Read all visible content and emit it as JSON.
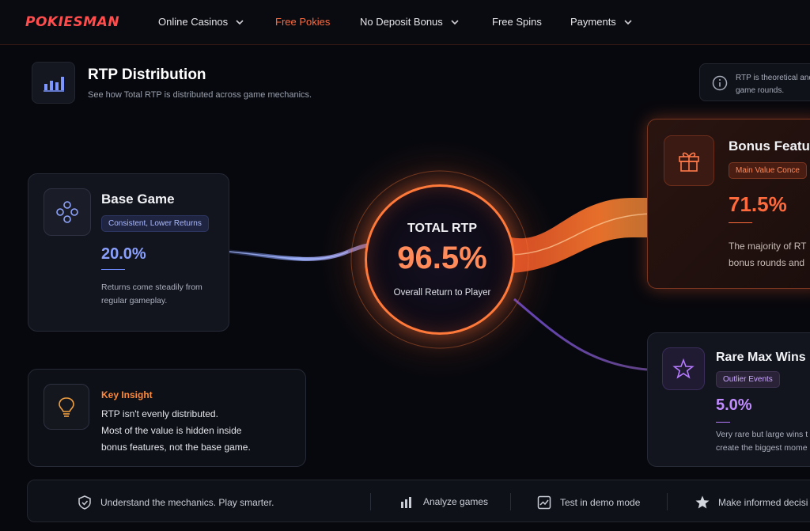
{
  "brand": {
    "logo": "POKIESMAN"
  },
  "nav": {
    "items": [
      {
        "label": "Online Casinos",
        "dropdown": true
      },
      {
        "label": "Free Pokies",
        "active": true
      },
      {
        "label": "No Deposit Bonus",
        "dropdown": true
      },
      {
        "label": "Free Spins"
      },
      {
        "label": "Payments",
        "dropdown": true
      }
    ]
  },
  "header": {
    "icon": "bar-chart-icon",
    "title": "RTP Distribution",
    "subtitle": "See how Total RTP is distributed across game mechanics.",
    "info_text": "RTP is theoretical and of game rounds."
  },
  "center": {
    "label": "TOTAL RTP",
    "value": "96.5%",
    "caption": "Overall Return to Player"
  },
  "cards": {
    "base": {
      "icon": "gamepad-icon",
      "title": "Base Game",
      "tag": "Consistent, Lower Returns",
      "value": "20.0%",
      "desc_line1": "Returns come steadily from",
      "desc_line2": "regular gameplay."
    },
    "bonus": {
      "icon": "gift-icon",
      "title": "Bonus Featu",
      "tag": "Main Value Conce",
      "value": "71.5%",
      "desc_line1": "The majority of RT",
      "desc_line2": "bonus rounds and"
    },
    "rare": {
      "icon": "star-icon",
      "title": "Rare Max Wins",
      "tag": "Outlier Events",
      "value": "5.0%",
      "desc_line1": "Very rare but large wins t",
      "desc_line2": "create the biggest mome"
    },
    "insight": {
      "icon": "lightbulb-icon",
      "title": "Key Insight",
      "line1": "RTP isn't evenly distributed.",
      "line2": "Most of the value is hidden inside",
      "line3": "bonus features, not the base game."
    }
  },
  "footer": {
    "items": [
      {
        "icon": "shield-check-icon",
        "label": "Understand the mechanics. Play smarter."
      },
      {
        "icon": "bar-chart-icon",
        "label": "Analyze games"
      },
      {
        "icon": "chart-box-icon",
        "label": "Test in demo mode"
      },
      {
        "icon": "star-icon",
        "label": "Make informed decisi"
      }
    ]
  },
  "colors": {
    "accent_orange": "#ff6a3d",
    "base_blue": "#6f8cff",
    "rare_purple": "#b67bff",
    "logo_red": "#ff4d4d"
  }
}
